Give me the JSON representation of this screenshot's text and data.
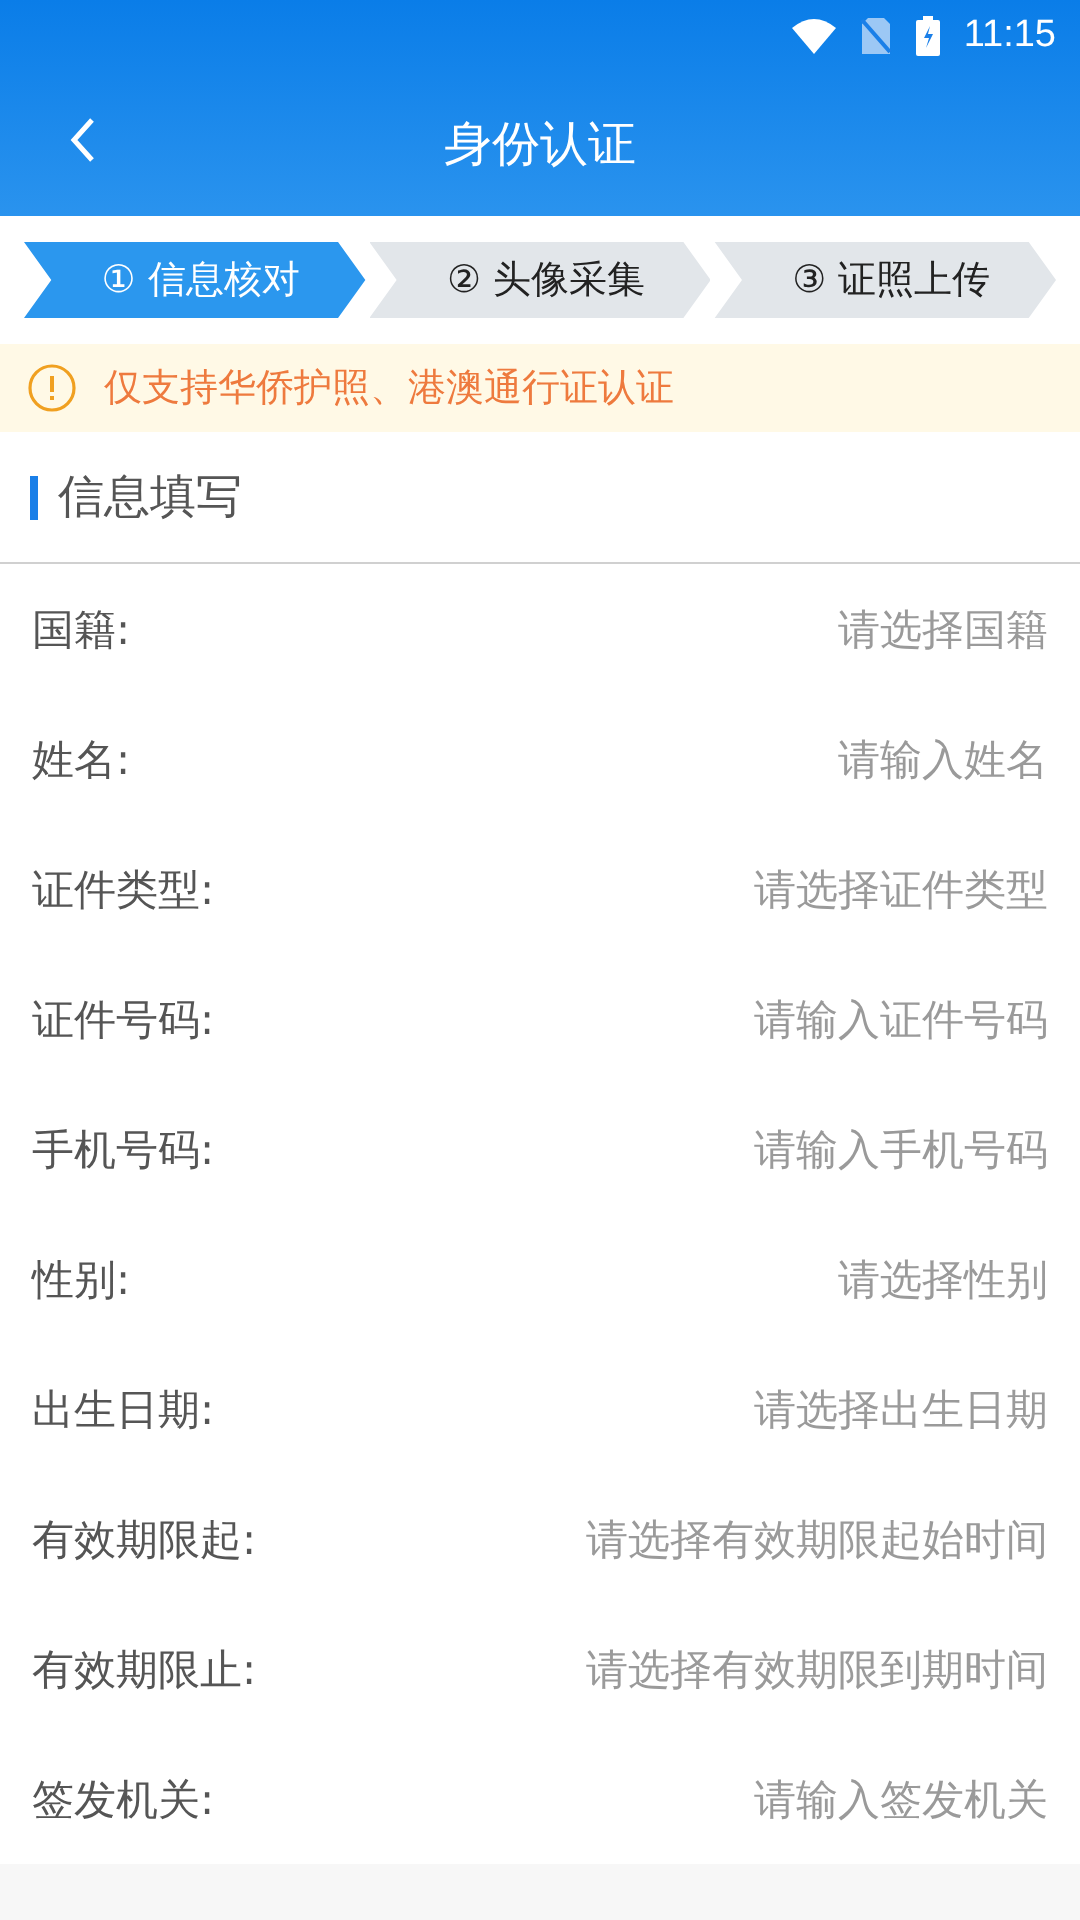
{
  "status_bar": {
    "time": "11:15"
  },
  "header": {
    "title": "身份认证"
  },
  "steps": [
    {
      "label": "① 信息核对",
      "selected": true
    },
    {
      "label": "② 头像采集",
      "selected": false
    },
    {
      "label": "③ 证照上传",
      "selected": false
    }
  ],
  "notice": "仅支持华侨护照、港澳通行证认证",
  "section_title": "信息填写",
  "fields": [
    {
      "label": "国籍:",
      "placeholder": "请选择国籍"
    },
    {
      "label": "姓名:",
      "placeholder": "请输入姓名"
    },
    {
      "label": "证件类型:",
      "placeholder": "请选择证件类型"
    },
    {
      "label": "证件号码:",
      "placeholder": "请输入证件号码"
    },
    {
      "label": "手机号码:",
      "placeholder": "请输入手机号码"
    },
    {
      "label": "性别:",
      "placeholder": "请选择性别"
    },
    {
      "label": "出生日期:",
      "placeholder": "请选择出生日期"
    },
    {
      "label": "有效期限起:",
      "placeholder": "请选择有效期限起始时间"
    },
    {
      "label": "有效期限止:",
      "placeholder": "请选择有效期限到期时间"
    },
    {
      "label": "签发机关:",
      "placeholder": "请输入签发机关"
    }
  ]
}
